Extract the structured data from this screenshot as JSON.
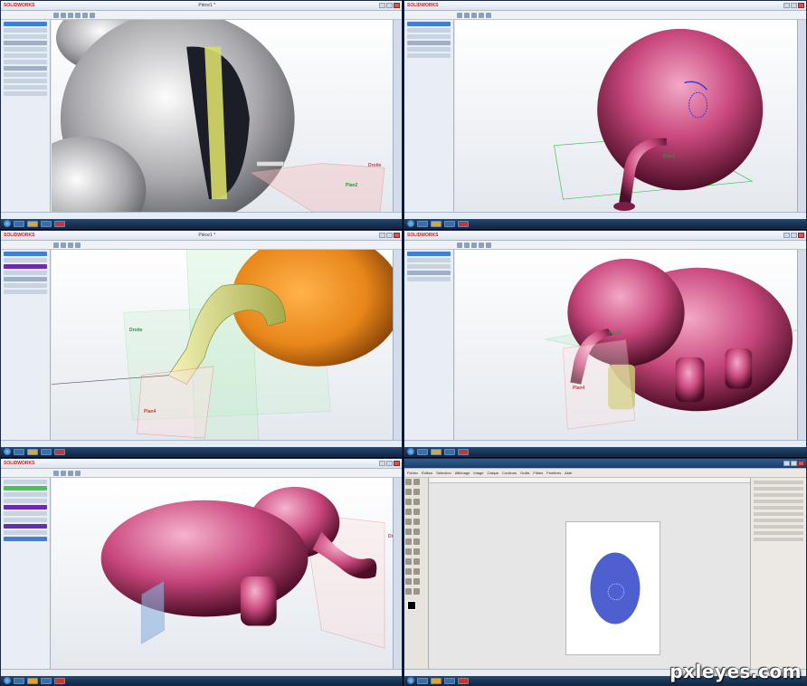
{
  "app": {
    "brand": "SOLIDWORKS",
    "gimp_menus": [
      "Fichier",
      "Édition",
      "Sélection",
      "Affichage",
      "Image",
      "Calque",
      "Couleurs",
      "Outils",
      "Filtres",
      "Fenêtres",
      "Aide"
    ]
  },
  "panels": [
    {
      "id": "p1",
      "title": "Pièce1 *",
      "labels": {
        "red": "Droite",
        "green": "Plan2"
      }
    },
    {
      "id": "p2",
      "title": "",
      "labels": {
        "red": "",
        "green": "Plan1"
      }
    },
    {
      "id": "p3",
      "title": "Pièce1 *",
      "labels": {
        "red": "Plan4",
        "green": "Droite"
      }
    },
    {
      "id": "p4",
      "title": "",
      "labels": {
        "red": "Plan4",
        "green": "Plan1"
      }
    },
    {
      "id": "p5",
      "title": "",
      "labels": {
        "red": "Droite",
        "green": ""
      }
    },
    {
      "id": "p6",
      "title": "",
      "labels": {
        "red": "",
        "green": ""
      }
    }
  ],
  "watermark": "pxleyes.com",
  "colors": {
    "body_pink": "#c9487d",
    "head_orange": "#e8861a",
    "trunk_yellow": "#e7ea8c",
    "gimp_oval": "#4e5fd0",
    "plane_red": "#f07a7a",
    "plane_green": "#39c64a"
  }
}
